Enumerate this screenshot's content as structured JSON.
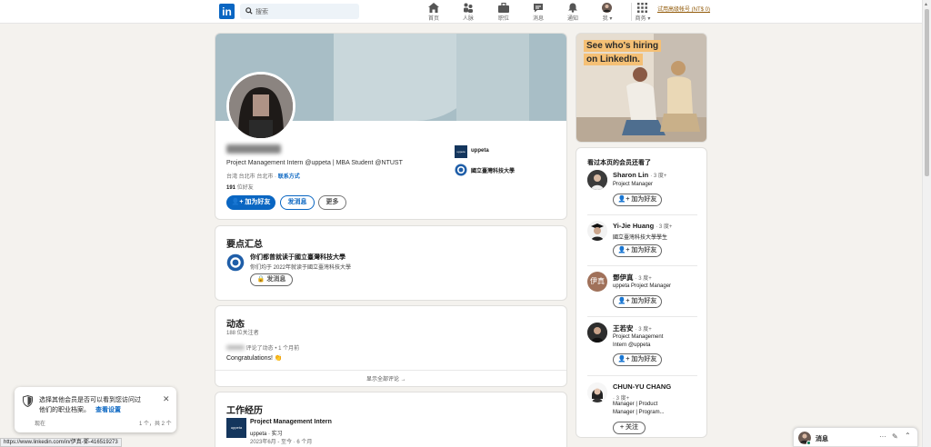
{
  "nav": {
    "logo": "in",
    "search_placeholder": "搜索",
    "items": [
      {
        "label": "首页",
        "icon": "home-icon"
      },
      {
        "label": "人脉",
        "icon": "people-icon"
      },
      {
        "label": "职位",
        "icon": "briefcase-icon"
      },
      {
        "label": "消息",
        "icon": "messaging-icon"
      },
      {
        "label": "通知",
        "icon": "bell-icon"
      },
      {
        "label": "我",
        "icon": "me-avatar"
      },
      {
        "label": "商务",
        "icon": "grid-icon"
      }
    ],
    "premium": "试用高级帐号 (NT$ 0)"
  },
  "profile": {
    "headline": "Project Management Intern @uppeta | MBA Student @NTUST",
    "location": "台湾 台北市 台北市",
    "contact_sep": "·",
    "contact": "联系方式",
    "connections_count": "191",
    "connections_label": "位好友",
    "buttons": {
      "connect": "加为好友",
      "message": "发消息",
      "more": "更多"
    },
    "orgs": [
      {
        "name": "uppeta",
        "logo_text": "uppeta"
      },
      {
        "name": "國立臺灣科技大學"
      }
    ]
  },
  "highlights": {
    "title": "要点汇总",
    "heading": "你们都曾就读于國立臺灣科技大學",
    "desc": "你们均于 2022年就读于國立臺灣科技大學",
    "button": "发消息"
  },
  "activity": {
    "title": "动态",
    "followers": "188 位关注者",
    "meta": "评论了动态 • 1 个月前",
    "comment": "Congratulations! 👏",
    "show_all": "显示全部评论 →"
  },
  "experience": {
    "title": "工作经历",
    "job_title": "Project Management Intern",
    "company": "uppeta · 实习",
    "dates": "2023年6月 - 至今 · 6 个月",
    "logo_text": "uppeta"
  },
  "ad": {
    "line1": "See who's hiring",
    "line2": "on LinkedIn."
  },
  "people_also_viewed": {
    "title": "看过本页的会员还看了",
    "people": [
      {
        "name": "Sharon Lin",
        "degree": "· 3 度+",
        "headline": [
          "Project Manager"
        ],
        "button": "加为好友",
        "initial": ""
      },
      {
        "name": "Yi-Jie Huang",
        "degree": "· 3 度+",
        "headline": [
          "國立臺灣科技大學學生"
        ],
        "button": "加为好友",
        "initial": ""
      },
      {
        "name": "鄧伊真",
        "degree": "· 3 度+",
        "headline": [
          "uppeta Project Manager"
        ],
        "button": "加为好友",
        "initial": "伊真"
      },
      {
        "name": "王若安",
        "degree": "· 3 度+",
        "headline": [
          "Project Management",
          "Intern @uppeta"
        ],
        "button": "加为好友",
        "initial": ""
      },
      {
        "name": "CHUN-YU CHANG",
        "degree": "· 3 度+",
        "headline": [
          "Manager | Product",
          "Manager | Program..."
        ],
        "button": "+ 关注",
        "initial": ""
      }
    ]
  },
  "toast": {
    "text_line1": "选择其他会员是否可以看到您访问过",
    "text_line2": "他们的职业档案。",
    "link": "查看设置",
    "time": "现在",
    "count": "1 个，共 2 个"
  },
  "status_url": "https://www.linkedin.com/in/伊真-鄧-416519273",
  "messaging": {
    "label": "消息"
  },
  "colors": {
    "brand": "#0a66c2",
    "premium": "#915907",
    "ad_text_bg": "#f5c075"
  }
}
